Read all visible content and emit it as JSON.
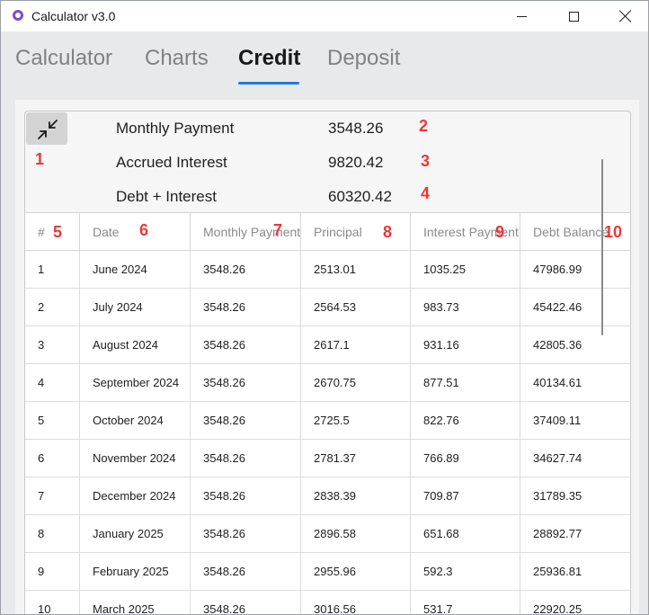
{
  "window": {
    "title": "Calculator v3.0",
    "app_icon": "app-logo-icon",
    "controls": {
      "minimize": "minimize-icon",
      "maximize": "maximize-icon",
      "close": "close-icon"
    }
  },
  "tabs": [
    {
      "label": "Calculator",
      "active": false
    },
    {
      "label": "Charts",
      "active": false
    },
    {
      "label": "Credit",
      "active": true
    },
    {
      "label": "Deposit",
      "active": false
    }
  ],
  "accent_color": "#1e7be0",
  "summary": {
    "collapse_icon": "collapse-arrows-icon",
    "rows": [
      {
        "label": "Monthly Payment",
        "value": "3548.26"
      },
      {
        "label": "Accrued Interest",
        "value": "9820.42"
      },
      {
        "label": "Debt + Interest",
        "value": "60320.42"
      }
    ]
  },
  "table": {
    "headers": [
      "#",
      "Date",
      "Monthly Payment",
      "Principal",
      "Interest Payment",
      "Debt Balance"
    ],
    "rows": [
      [
        "1",
        "June 2024",
        "3548.26",
        "2513.01",
        "1035.25",
        "47986.99"
      ],
      [
        "2",
        "July 2024",
        "3548.26",
        "2564.53",
        "983.73",
        "45422.46"
      ],
      [
        "3",
        "August 2024",
        "3548.26",
        "2617.1",
        "931.16",
        "42805.36"
      ],
      [
        "4",
        "September 2024",
        "3548.26",
        "2670.75",
        "877.51",
        "40134.61"
      ],
      [
        "5",
        "October 2024",
        "3548.26",
        "2725.5",
        "822.76",
        "37409.11"
      ],
      [
        "6",
        "November 2024",
        "3548.26",
        "2781.37",
        "766.89",
        "34627.74"
      ],
      [
        "7",
        "December 2024",
        "3548.26",
        "2838.39",
        "709.87",
        "31789.35"
      ],
      [
        "8",
        "January 2025",
        "3548.26",
        "2896.58",
        "651.68",
        "28892.77"
      ],
      [
        "9",
        "February 2025",
        "3548.26",
        "2955.96",
        "592.3",
        "25936.81"
      ],
      [
        "10",
        "March 2025",
        "3548.26",
        "3016.56",
        "531.7",
        "22920.25"
      ]
    ]
  },
  "annotation_badges": [
    "1",
    "2",
    "3",
    "4",
    "5",
    "6",
    "7",
    "8",
    "9",
    "10"
  ],
  "badge_color": "#e8383d"
}
